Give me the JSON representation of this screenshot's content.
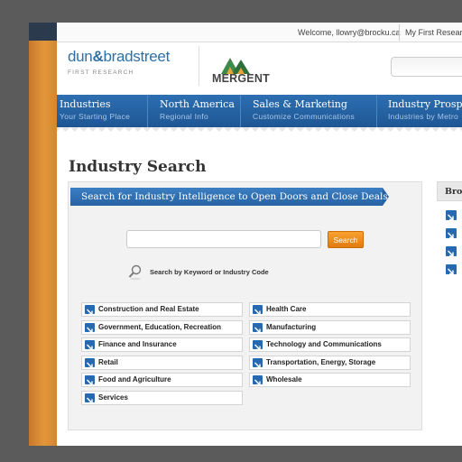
{
  "utility": {
    "welcome": "Welcome, llowry@brocku.ca",
    "my_first_research": "My First Research"
  },
  "logos": {
    "dnb_part1": "dun",
    "dnb_amp": "&",
    "dnb_part2": "bradstreet",
    "dnb_sub": "FIRST RESEARCH",
    "mergent": "MERGENT"
  },
  "nav": [
    {
      "title": "Industries",
      "subtitle": "Your Starting Place"
    },
    {
      "title": "North America",
      "subtitle": "Regional Info"
    },
    {
      "title": "Sales & Marketing",
      "subtitle": "Customize Communications"
    },
    {
      "title": "Industry Prospect",
      "subtitle": "Industries by Metro"
    }
  ],
  "page_title": "Industry Search",
  "banner": "Search for Industry Intelligence to Open Doors and Close Deals",
  "search": {
    "placeholder": "",
    "button": "Search",
    "hint": "Search by Keyword or Industry Code"
  },
  "industries": {
    "left": [
      "Construction and Real Estate",
      "Government, Education, Recreation",
      "Finance and Insurance",
      "Retail",
      "Food and Agriculture",
      "Services"
    ],
    "right": [
      "Health Care",
      "Manufacturing",
      "Technology and Communications",
      "Transportation, Energy, Storage",
      "Wholesale"
    ]
  },
  "browse": {
    "title": "Brow"
  },
  "colors": {
    "nav_blue": "#2d6fb2",
    "accent_orange": "#e3973c",
    "search_button": "#f08c20",
    "arrow_blue": "#2769b0"
  },
  "icons": {
    "industry_arrow": "arrow-down-right-icon",
    "search_hint": "magnifier-icon"
  }
}
